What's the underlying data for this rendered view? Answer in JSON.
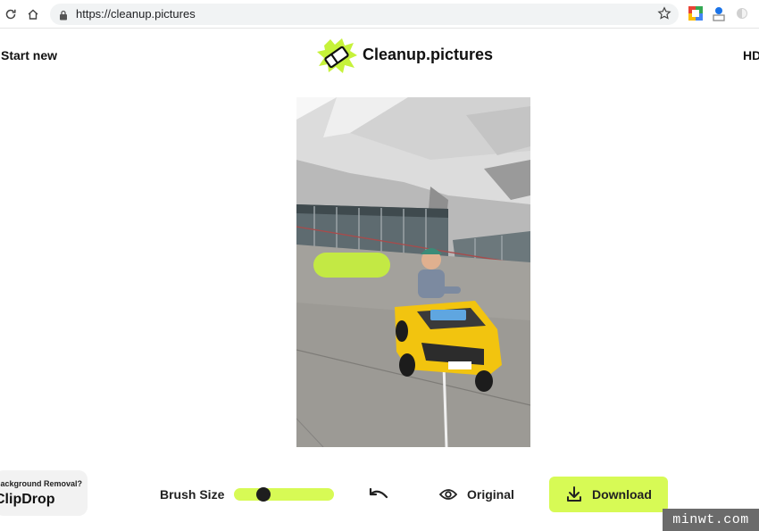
{
  "browser": {
    "url": "https://cleanup.pictures",
    "icons": [
      "reload-icon",
      "home-icon",
      "lock-icon",
      "star-icon",
      "extension-icon"
    ]
  },
  "header": {
    "start_new": "Start new",
    "logo_text": "Cleanup.pictures",
    "hd": "HD"
  },
  "bottom_bar": {
    "clipdrop_question": "Background Removal?",
    "clipdrop_name": "ClipDrop",
    "brush_size_label": "Brush Size",
    "brush_size_value": 0.26,
    "original_label": "Original",
    "download_label": "Download"
  },
  "watermark": "minwt.com",
  "colors": {
    "accent": "#d7fa55",
    "text": "#222222",
    "chip_bg": "#f2f2f2"
  }
}
